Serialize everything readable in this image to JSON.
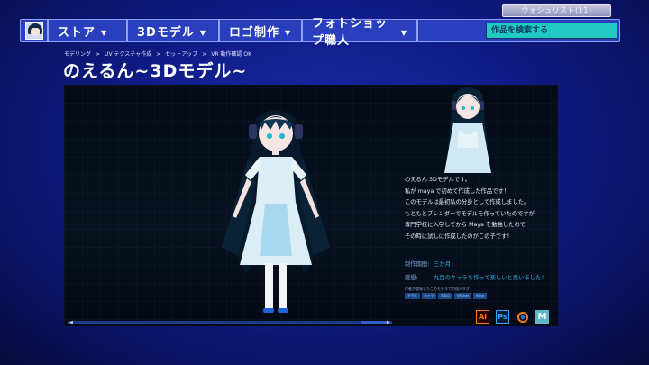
{
  "header": {
    "wishlist_label": "ウォシュリスト(11)",
    "nav_items": [
      {
        "label": "ストア"
      },
      {
        "label": "3Dモデル"
      },
      {
        "label": "ロゴ制作"
      },
      {
        "label": "フォトショップ職人"
      }
    ],
    "search_placeholder": "作品を検索する"
  },
  "breadcrumb": [
    "モデリング",
    "UV テクスチャ作成",
    "セットアップ",
    "VR 動作確認 OK"
  ],
  "page_title": "のえるん~3Dモデル~",
  "description": [
    "のえるん 3Dモデルです。",
    "私が maya で初めて作成した作品です！",
    "このモデルは最初私の分身として作成しました。",
    "もともとブレンダーでモデルを作っていたのですが",
    "専門学校に入学してから Maya を勉強したので",
    "その時に試しに作成したのがこの子です！"
  ],
  "meta": {
    "period_label": "制作期間:",
    "period_value": "三か月",
    "impression_label": "感想:",
    "impression_value": "丸目のキャラも作って楽しいと思いました！"
  },
  "tags_label": "作者が登録したこのモデルでの個人タグ",
  "tags": [
    "モデル",
    "キャラ",
    "3DCG",
    "VRChat",
    "Maya"
  ],
  "tools": [
    {
      "icon": "illustrator-icon",
      "text": "Ai"
    },
    {
      "icon": "photoshop-icon",
      "text": "Ps"
    },
    {
      "icon": "blender-icon",
      "text": ""
    },
    {
      "icon": "maya-icon",
      "text": "M"
    }
  ],
  "colors": {
    "accent_teal": "#20c9c2",
    "nav_blue": "#2a3fbd",
    "background_blue": "#1a2aa8"
  }
}
